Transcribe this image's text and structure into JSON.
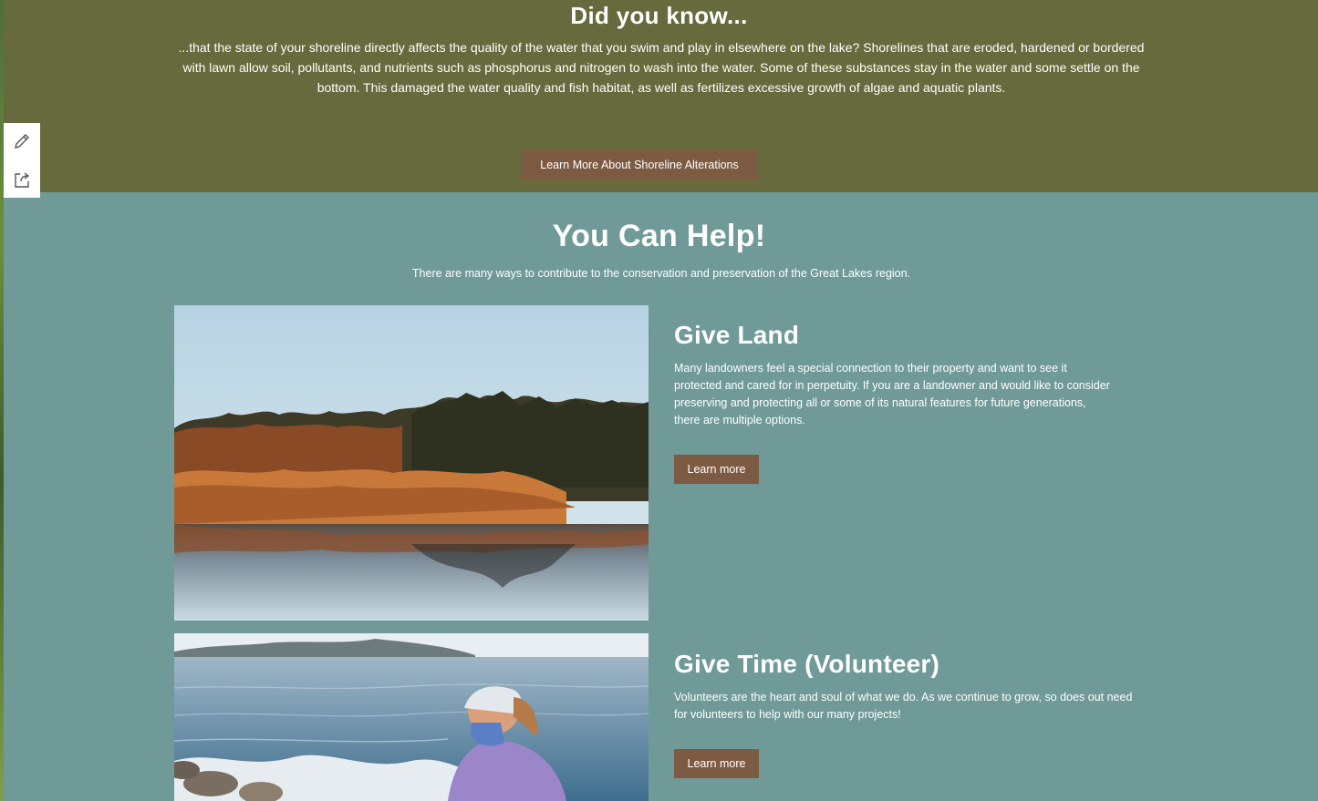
{
  "did_you_know": {
    "title": "Did you know...",
    "text": "...that the state of your shoreline directly affects the quality of the water that you swim and play in elsewhere on the lake? Shorelines that are eroded, hardened or bordered with lawn allow soil, pollutants, and nutrients such as phosphorus and nitrogen to wash into the water. Some of these substances stay in the water and some settle on the bottom. This damaged the water quality and fish habitat, as well as fertilizes excessive growth of algae and aquatic plants.",
    "button_label": "Learn More About Shoreline Alterations"
  },
  "toolbar": {
    "items": [
      {
        "icon": "pencil-icon"
      },
      {
        "icon": "share-icon"
      }
    ]
  },
  "you_can_help": {
    "title": "You Can Help!",
    "subtitle": "There are many ways to contribute to the conservation and preservation of the Great Lakes region."
  },
  "cards": [
    {
      "title": "Give Land",
      "text": "Many landowners feel a special connection to their property and want to see it protected and cared for in perpetuity. If you are a landowner and would like to consider preserving and protecting all or some of its natural features for future generations, there are multiple options.",
      "button_label": "Learn more",
      "image": "autumn-marsh-reflection-photo"
    },
    {
      "title": "Give Time (Volunteer)",
      "text": "Volunteers are the heart and soul of what we do. As we continue to grow, so does out need for volunteers to help with our many projects!",
      "button_label": "Learn more",
      "image": "volunteer-shoreline-cleanup-photo"
    }
  ],
  "colors": {
    "top_section_bg": "#676a3c",
    "main_bg": "#6f9a98",
    "button_bg": "#7d5b42",
    "text": "#ffffff"
  }
}
